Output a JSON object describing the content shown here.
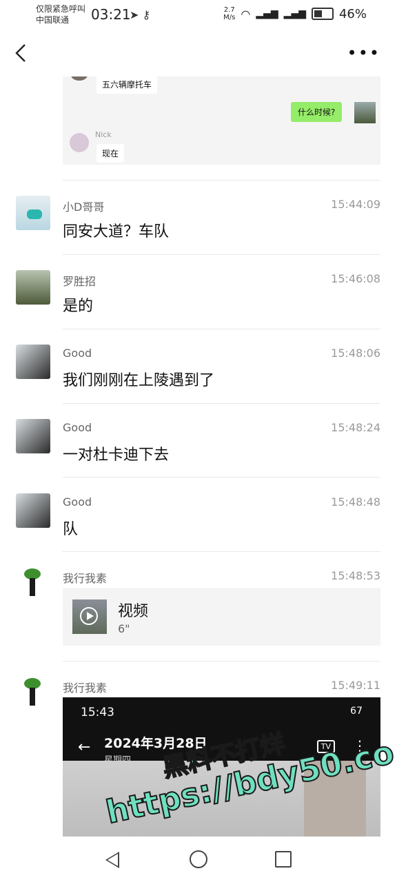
{
  "status_bar": {
    "carrier_line1": "仅限紧急呼叫",
    "carrier_line2": "中国联通",
    "time": "03:21",
    "speed_value": "2.7",
    "speed_unit": "M/s",
    "battery_percent": "46%",
    "battery_level": 0.46
  },
  "quoted": {
    "top_text": "五六辆摩托车",
    "green_text": "什么时候?",
    "nick_name": "Nick",
    "nick_text": "现在"
  },
  "messages": [
    {
      "name": "小D哥哥",
      "time": "15:44:09",
      "text": "同安大道？车队"
    },
    {
      "name": "罗胜招",
      "time": "15:46:08",
      "text": "是的"
    },
    {
      "name": "Good",
      "time": "15:48:06",
      "text": "我们刚刚在上陵遇到了"
    },
    {
      "name": "Good",
      "time": "15:48:24",
      "text": "一对杜卡迪下去"
    },
    {
      "name": "Good",
      "time": "15:48:48",
      "text": "队"
    },
    {
      "name": "我行我素",
      "time": "15:48:53",
      "video_title": "视频",
      "video_duration": "6\""
    },
    {
      "name": "我行我素",
      "time": "15:49:11"
    }
  ],
  "screenshot": {
    "time": "15:43",
    "status": "67",
    "date": "2024年3月28日",
    "weekday": "星期四",
    "tv_label": "TV"
  },
  "watermark": {
    "line1": "黑料不打烊",
    "line2": "https://bdy50.co"
  },
  "colors": {
    "accent_green": "#95ec69",
    "watermark": "#6ee0c0"
  }
}
